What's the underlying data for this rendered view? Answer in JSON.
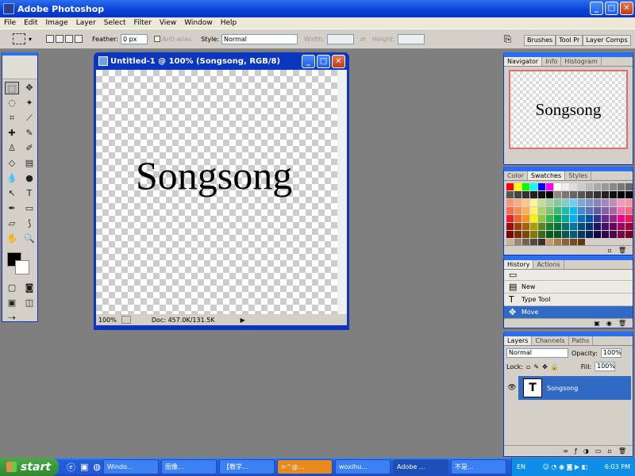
{
  "app": {
    "title": "Adobe Photoshop",
    "win_min": "_",
    "win_max": "□",
    "win_close": "✕"
  },
  "menu": [
    "File",
    "Edit",
    "Image",
    "Layer",
    "Select",
    "Filter",
    "View",
    "Window",
    "Help"
  ],
  "options": {
    "feather_label": "Feather:",
    "feather_value": "0 px",
    "antialias_label": "Anti-alias",
    "style_label": "Style:",
    "style_value": "Normal",
    "width_label": "Width:",
    "height_label": "Height:",
    "wells": [
      "Brushes",
      "Tool Pr",
      "Layer Comps"
    ]
  },
  "document": {
    "title": "Untitled-1 @ 100% (Songsong, RGB/8)",
    "canvas_text": "Songsong",
    "zoom": "100%",
    "doc_info": "Doc: 457.0K/131.5K"
  },
  "navigator": {
    "tabs": [
      "Navigator",
      "Info",
      "Histogram"
    ],
    "preview_text": "Songsong"
  },
  "swatches": {
    "tabs": [
      "Color",
      "Swatches",
      "Styles"
    ]
  },
  "history": {
    "tabs": [
      "History",
      "Actions"
    ],
    "items": [
      "New",
      "Type Tool",
      "Move"
    ],
    "selected": "Move"
  },
  "layers": {
    "tabs": [
      "Layers",
      "Channels",
      "Paths"
    ],
    "blend_mode": "Normal",
    "opacity_label": "Opacity:",
    "opacity": "100%",
    "lock_label": "Lock:",
    "fill_label": "Fill:",
    "fill": "100%",
    "layer_name": "Songsong",
    "thumb_glyph": "T"
  },
  "taskbar": {
    "start": "start",
    "items": [
      "Windo...",
      "图像...",
      "【教学...",
      ">^@...",
      "woxihu...",
      "Adobe ...",
      "不是..."
    ],
    "active": "Adobe ...",
    "lang": "EN",
    "clock": "6:03 PM"
  }
}
